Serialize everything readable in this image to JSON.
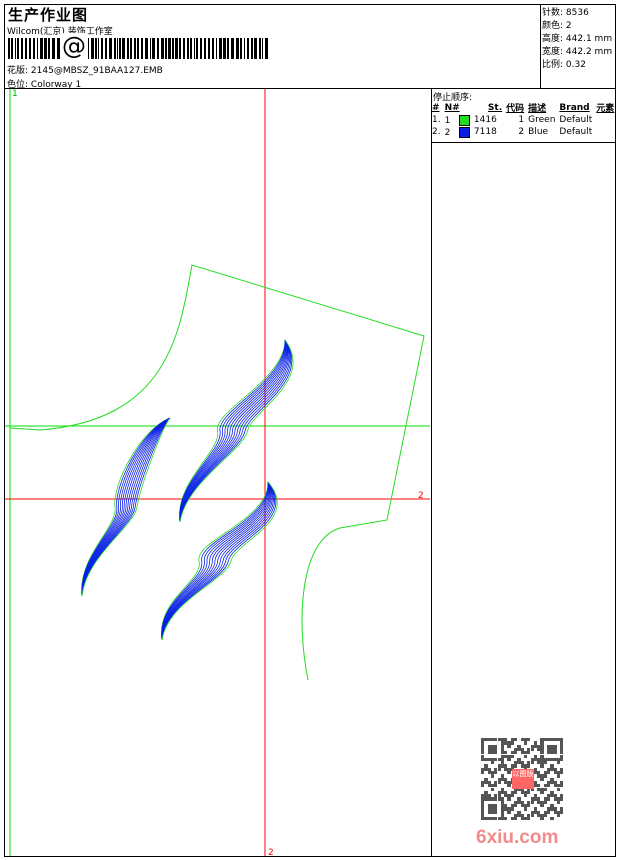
{
  "header": {
    "title": "生产作业图",
    "company": "Wilcom(汇京) 装饰工作室",
    "barcode_symbol": "@",
    "file_label": "花版:",
    "file_name": "2145@MBSZ_91BAA127.EMB",
    "colorway_label": "色位:",
    "colorway": "Colorway 1"
  },
  "info": [
    {
      "label": "针数:",
      "value": "8536"
    },
    {
      "label": "颜色:",
      "value": "2"
    },
    {
      "label": "高度:",
      "value": "442.1 mm"
    },
    {
      "label": "宽度:",
      "value": "442.2 mm"
    },
    {
      "label": "比例:",
      "value": "0.32"
    }
  ],
  "stop_sequence": {
    "title": "停止顺序:",
    "columns": [
      "#",
      "N#",
      "St.",
      "代码",
      "描述",
      "Brand",
      "元素"
    ],
    "rows": [
      {
        "idx": "1.",
        "n": "1",
        "color": "#22dd22",
        "stitches": "1416",
        "code": "1",
        "desc": "Green",
        "brand": "Default"
      },
      {
        "idx": "2.",
        "n": "2",
        "color": "#0a1ee6",
        "stitches": "7118",
        "code": "2",
        "desc": "Blue",
        "brand": "Default"
      }
    ]
  },
  "design": {
    "marker_top": "1",
    "marker_right": "2",
    "marker_bottom": "2",
    "colors": {
      "guide": "#00dd00",
      "axis": "#ff0000",
      "outline": "#22dd22",
      "fill": "#0a1ee6"
    }
  },
  "watermark": "6xiu.com",
  "qr_stamp": "以图版"
}
